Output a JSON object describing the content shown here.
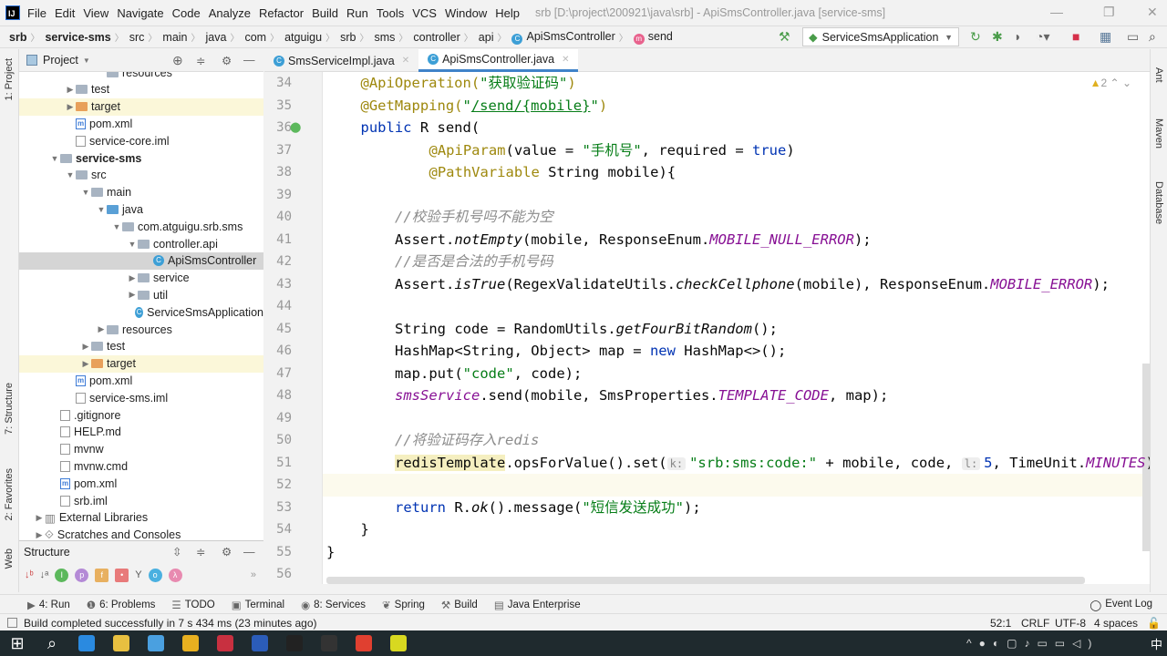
{
  "menu": {
    "items": [
      "File",
      "Edit",
      "View",
      "Navigate",
      "Code",
      "Analyze",
      "Refactor",
      "Build",
      "Run",
      "Tools",
      "VCS",
      "Window",
      "Help"
    ],
    "window_title": "srb [D:\\project\\200921\\java\\srb] - ApiSmsController.java [service-sms]"
  },
  "breadcrumb": [
    "srb",
    "service-sms",
    "src",
    "main",
    "java",
    "com",
    "atguigu",
    "srb",
    "sms",
    "controller",
    "api",
    "ApiSmsController",
    "send"
  ],
  "toolbar": {
    "run_config": "ServiceSmsApplication"
  },
  "left_strip": [
    "1: Project",
    "7: Structure",
    "2: Favorites",
    "Web"
  ],
  "right_strip": [
    "Ant",
    "Maven",
    "Database"
  ],
  "project": {
    "title": "Project",
    "tree": [
      {
        "label": "resources",
        "level": 5,
        "icon": "folder",
        "arrow": ""
      },
      {
        "label": "test",
        "level": 3,
        "icon": "folder",
        "arrow": "right"
      },
      {
        "label": "target",
        "level": 3,
        "icon": "folder-orange",
        "arrow": "right",
        "hl": true
      },
      {
        "label": "pom.xml",
        "level": 3,
        "icon": "maven",
        "arrow": ""
      },
      {
        "label": "service-core.iml",
        "level": 3,
        "icon": "file",
        "arrow": ""
      },
      {
        "label": "service-sms",
        "level": 2,
        "icon": "folder",
        "arrow": "down",
        "bold": true
      },
      {
        "label": "src",
        "level": 3,
        "icon": "folder",
        "arrow": "down"
      },
      {
        "label": "main",
        "level": 4,
        "icon": "folder",
        "arrow": "down"
      },
      {
        "label": "java",
        "level": 5,
        "icon": "folder-src",
        "arrow": "down"
      },
      {
        "label": "com.atguigu.srb.sms",
        "level": 6,
        "icon": "folder",
        "arrow": "down"
      },
      {
        "label": "controller.api",
        "level": 7,
        "icon": "folder",
        "arrow": "down"
      },
      {
        "label": "ApiSmsController",
        "level": 8,
        "icon": "class",
        "arrow": "",
        "sel": true
      },
      {
        "label": "service",
        "level": 7,
        "icon": "folder",
        "arrow": "right"
      },
      {
        "label": "util",
        "level": 7,
        "icon": "folder",
        "arrow": "right"
      },
      {
        "label": "ServiceSmsApplication",
        "level": 7,
        "icon": "class",
        "arrow": ""
      },
      {
        "label": "resources",
        "level": 5,
        "icon": "folder",
        "arrow": "right"
      },
      {
        "label": "test",
        "level": 4,
        "icon": "folder",
        "arrow": "right"
      },
      {
        "label": "target",
        "level": 4,
        "icon": "folder-orange",
        "arrow": "right",
        "hl": true
      },
      {
        "label": "pom.xml",
        "level": 3,
        "icon": "maven",
        "arrow": ""
      },
      {
        "label": "service-sms.iml",
        "level": 3,
        "icon": "file",
        "arrow": ""
      },
      {
        "label": ".gitignore",
        "level": 2,
        "icon": "file",
        "arrow": ""
      },
      {
        "label": "HELP.md",
        "level": 2,
        "icon": "file",
        "arrow": ""
      },
      {
        "label": "mvnw",
        "level": 2,
        "icon": "file",
        "arrow": ""
      },
      {
        "label": "mvnw.cmd",
        "level": 2,
        "icon": "file",
        "arrow": ""
      },
      {
        "label": "pom.xml",
        "level": 2,
        "icon": "maven",
        "arrow": ""
      },
      {
        "label": "srb.iml",
        "level": 2,
        "icon": "file",
        "arrow": ""
      },
      {
        "label": "External Libraries",
        "level": 1,
        "icon": "library",
        "arrow": "right"
      },
      {
        "label": "Scratches and Consoles",
        "level": 1,
        "icon": "scratch",
        "arrow": "right"
      }
    ]
  },
  "structure": {
    "title": "Structure"
  },
  "tabs": [
    {
      "label": "SmsServiceImpl.java",
      "active": false
    },
    {
      "label": "ApiSmsController.java",
      "active": true
    }
  ],
  "editor": {
    "warnings": "2",
    "current_line": 52,
    "lines": [
      {
        "n": "34",
        "i": 1,
        "t": [
          [
            "@ApiOperation(",
            "ann"
          ],
          [
            "\"获取验证码\"",
            "str"
          ],
          [
            ")",
            "ann"
          ]
        ]
      },
      {
        "n": "35",
        "i": 1,
        "t": [
          [
            "@GetMapping(",
            "ann"
          ],
          [
            "\"",
            "str"
          ],
          [
            "/send/{mobile}",
            "str u"
          ],
          [
            "\"",
            "str"
          ],
          [
            ")",
            "ann"
          ]
        ]
      },
      {
        "n": "36",
        "i": 1,
        "t": [
          [
            "public ",
            "kw"
          ],
          [
            "R send(",
            ""
          ]
        ]
      },
      {
        "n": "37",
        "i": 3,
        "t": [
          [
            "@ApiParam",
            "ann"
          ],
          [
            "(value = ",
            ""
          ],
          [
            "\"手机号\"",
            "str"
          ],
          [
            ", required = ",
            ""
          ],
          [
            "true",
            "kw"
          ],
          [
            ")",
            ""
          ]
        ]
      },
      {
        "n": "38",
        "i": 3,
        "t": [
          [
            "@PathVariable",
            "ann"
          ],
          [
            " String mobile){",
            ""
          ]
        ]
      },
      {
        "n": "39",
        "i": 0,
        "t": []
      },
      {
        "n": "40",
        "i": 2,
        "t": [
          [
            "//校验手机号吗不能为空",
            "cmt"
          ]
        ]
      },
      {
        "n": "41",
        "i": 2,
        "t": [
          [
            "Assert.",
            ""
          ],
          [
            "notEmpty",
            "st"
          ],
          [
            "(mobile, ResponseEnum.",
            ""
          ],
          [
            "MOBILE_NULL_ERROR",
            "cst"
          ],
          [
            ");",
            ""
          ]
        ]
      },
      {
        "n": "42",
        "i": 2,
        "t": [
          [
            "//是否是合法的手机号码",
            "cmt"
          ]
        ]
      },
      {
        "n": "43",
        "i": 2,
        "t": [
          [
            "Assert.",
            ""
          ],
          [
            "isTrue",
            "st"
          ],
          [
            "(RegexValidateUtils.",
            ""
          ],
          [
            "checkCellphone",
            "st"
          ],
          [
            "(mobile), ResponseEnum.",
            ""
          ],
          [
            "MOBILE_ERROR",
            "cst"
          ],
          [
            ");",
            ""
          ]
        ]
      },
      {
        "n": "44",
        "i": 0,
        "t": []
      },
      {
        "n": "45",
        "i": 2,
        "t": [
          [
            "String code = RandomUtils.",
            ""
          ],
          [
            "getFourBitRandom",
            "st"
          ],
          [
            "();",
            ""
          ]
        ]
      },
      {
        "n": "46",
        "i": 2,
        "t": [
          [
            "HashMap<String, Object> map = ",
            ""
          ],
          [
            "new ",
            "kw"
          ],
          [
            "HashMap<>();",
            ""
          ]
        ]
      },
      {
        "n": "47",
        "i": 2,
        "t": [
          [
            "map.put(",
            ""
          ],
          [
            "\"code\"",
            "str"
          ],
          [
            ", code);",
            ""
          ]
        ]
      },
      {
        "n": "48",
        "i": 2,
        "t": [
          [
            "smsService",
            "cst"
          ],
          [
            ".send(mobile, SmsProperties.",
            ""
          ],
          [
            "TEMPLATE_CODE",
            "cst"
          ],
          [
            ", map);",
            ""
          ]
        ]
      },
      {
        "n": "49",
        "i": 0,
        "t": []
      },
      {
        "n": "50",
        "i": 2,
        "t": [
          [
            "//将验证码存入",
            "cmt"
          ],
          [
            "redis",
            "cmt"
          ]
        ]
      },
      {
        "n": "51",
        "i": 2,
        "t": [
          [
            "redisTemplate",
            "hlbg"
          ],
          [
            ".opsForValue().set(",
            ""
          ],
          [
            "k:",
            "hint"
          ],
          [
            "\"srb:sms:code:\"",
            "str"
          ],
          [
            " + mobile, code, ",
            ""
          ],
          [
            "l:",
            "hint"
          ],
          [
            "5",
            "kw"
          ],
          [
            ", TimeUnit.",
            ""
          ],
          [
            "MINUTES",
            "cst"
          ],
          [
            ");",
            ""
          ]
        ]
      },
      {
        "n": "52",
        "i": 0,
        "t": []
      },
      {
        "n": "53",
        "i": 2,
        "t": [
          [
            "return ",
            "kw"
          ],
          [
            "R.",
            ""
          ],
          [
            "ok",
            "st"
          ],
          [
            "().message(",
            ""
          ],
          [
            "\"短信发送成功\"",
            "str"
          ],
          [
            ");",
            ""
          ]
        ]
      },
      {
        "n": "54",
        "i": 1,
        "t": [
          [
            "}",
            ""
          ]
        ]
      },
      {
        "n": "55",
        "i": 0,
        "t": [
          [
            "}",
            ""
          ]
        ]
      },
      {
        "n": "56",
        "i": 0,
        "t": []
      }
    ]
  },
  "bottom_tools": [
    {
      "label": "4: Run",
      "icon": "run-icon"
    },
    {
      "label": "6: Problems",
      "icon": "problems-icon"
    },
    {
      "label": "TODO",
      "icon": "todo-icon"
    },
    {
      "label": "Terminal",
      "icon": "terminal-icon"
    },
    {
      "label": "8: Services",
      "icon": "services-icon"
    },
    {
      "label": "Spring",
      "icon": "spring-icon"
    },
    {
      "label": "Build",
      "icon": "build-icon"
    },
    {
      "label": "Java Enterprise",
      "icon": "java-enterprise-icon"
    }
  ],
  "event_log": "Event Log",
  "status": {
    "message": "Build completed successfully in 7 s 434 ms (23 minutes ago)",
    "position": "52:1",
    "line_sep": "CRLF",
    "encoding": "UTF-8",
    "indent": "4 spaces"
  },
  "taskbar": {
    "tray_ime": "中",
    "apps": [
      "start",
      "search",
      "vscode",
      "explorer",
      "app-blue",
      "app-copy",
      "app-red",
      "word",
      "intellij",
      "cmd",
      "chrome",
      "app-yellow"
    ]
  },
  "colors": {
    "accent": "#4083c9",
    "keyword": "#0033b3",
    "string": "#067d17",
    "annotation": "#9e880d",
    "constant": "#871094"
  }
}
